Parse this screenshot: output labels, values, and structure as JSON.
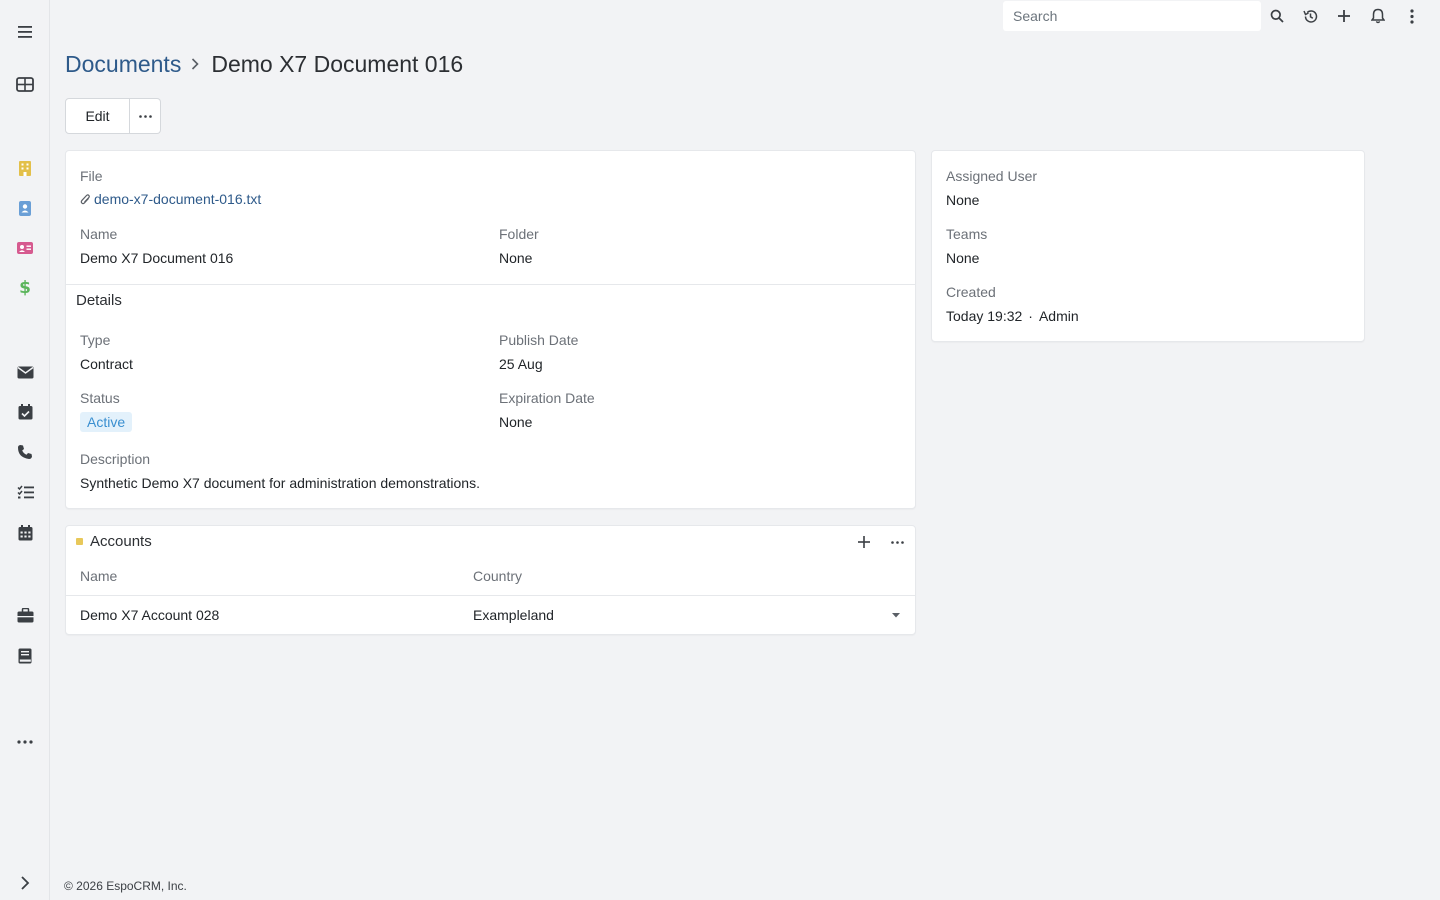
{
  "topbar": {
    "search_placeholder": "Search"
  },
  "breadcrumb": {
    "parent": "Documents",
    "current": "Demo X7 Document 016"
  },
  "actions": {
    "edit_label": "Edit"
  },
  "main_panel": {
    "file_label": "File",
    "file_name": "demo-x7-document-016.txt",
    "name_label": "Name",
    "name_value": "Demo X7 Document 016",
    "folder_label": "Folder",
    "folder_value": "None",
    "details_title": "Details",
    "type_label": "Type",
    "type_value": "Contract",
    "publish_date_label": "Publish Date",
    "publish_date_value": "25 Aug",
    "status_label": "Status",
    "status_value": "Active",
    "expiration_date_label": "Expiration Date",
    "expiration_date_value": "None",
    "description_label": "Description",
    "description_value": "Synthetic Demo X7 document for administration demonstrations."
  },
  "side_panel": {
    "assigned_user_label": "Assigned User",
    "assigned_user_value": "None",
    "teams_label": "Teams",
    "teams_value": "None",
    "created_label": "Created",
    "created_time": "Today 19:32",
    "created_separator": "·",
    "created_by": "Admin"
  },
  "accounts_panel": {
    "title": "Accounts",
    "columns": [
      "Name",
      "Country"
    ],
    "rows": [
      {
        "name": "Demo X7 Account 028",
        "country": "Exampleland"
      }
    ]
  },
  "footer": {
    "text": "© 2026 EspoCRM, Inc."
  },
  "colors": {
    "link": "#2e5a8a",
    "badge_bg": "#e3f1fb",
    "badge_text": "#3a8fd0",
    "accounts_square": "#e8c85a",
    "nav_accounts": "#e3c04a",
    "nav_contacts": "#6a9fd6",
    "nav_leads": "#d65a8f",
    "nav_opportunities": "#5bb55b"
  },
  "sidebar_icons": [
    "menu-icon",
    "grid-icon",
    "building-icon",
    "contact-icon",
    "id-card-icon",
    "dollar-icon",
    "envelope-icon",
    "calendar-check-icon",
    "phone-icon",
    "tasks-icon",
    "calendar-icon",
    "briefcase-icon",
    "book-icon",
    "more-icon",
    "chevron-right-icon"
  ]
}
